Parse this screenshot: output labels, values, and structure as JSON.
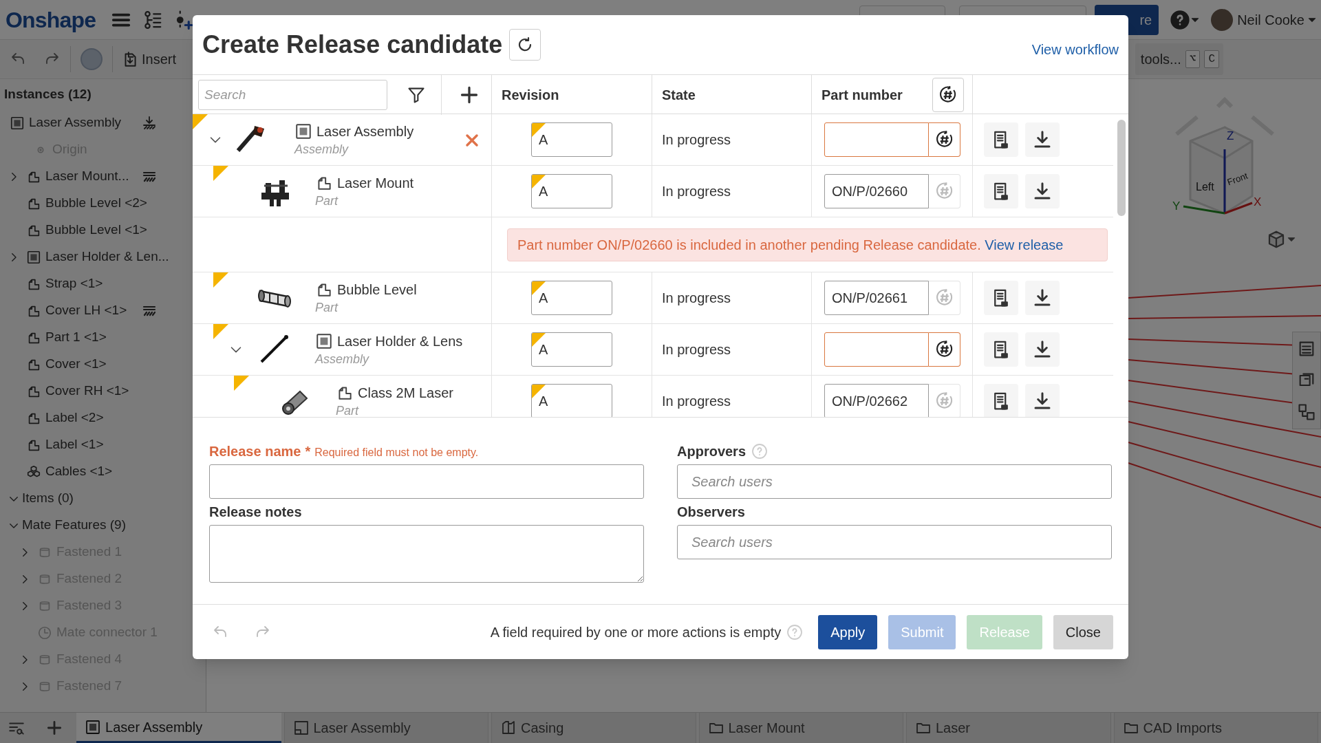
{
  "topbar": {
    "logo": "Onshape",
    "insert": "Insert",
    "share_button": "re",
    "user": "Neil Cooke",
    "search_hint": "tools...",
    "shortcut_keys": [
      "⌥",
      "C"
    ]
  },
  "sidebar": {
    "title": "Instances (12)",
    "tree": [
      {
        "label": "Laser Assembly",
        "kind": "assembly",
        "disabled": false,
        "fixed": true,
        "children": [
          {
            "label": "Origin",
            "kind": "origin",
            "disabled": true
          },
          {
            "label": "Laser Mount...",
            "kind": "part",
            "expanded": false,
            "disabled": false,
            "sectioned": true
          },
          {
            "label": "Bubble Level <2>",
            "kind": "part",
            "disabled": false
          },
          {
            "label": "Bubble Level <1>",
            "kind": "part",
            "disabled": false
          },
          {
            "label": "Laser Holder & Len...",
            "kind": "assembly",
            "expanded": false,
            "disabled": false
          },
          {
            "label": "Strap <1>",
            "kind": "part",
            "disabled": false
          },
          {
            "label": "Cover LH <1>",
            "kind": "part",
            "disabled": false,
            "sectioned": true
          },
          {
            "label": "Part 1 <1>",
            "kind": "part",
            "disabled": false
          },
          {
            "label": "Cover <1>",
            "kind": "part",
            "disabled": false
          },
          {
            "label": "Cover RH <1>",
            "kind": "part",
            "disabled": false
          },
          {
            "label": "Label <2>",
            "kind": "part",
            "disabled": false
          },
          {
            "label": "Label <1>",
            "kind": "part",
            "disabled": false
          },
          {
            "label": "Cables <1>",
            "kind": "multipart",
            "disabled": false
          }
        ]
      },
      {
        "label": "Items (0)",
        "kind": "group",
        "expanded": true,
        "disabled": false
      },
      {
        "label": "Mate Features (9)",
        "kind": "group",
        "expanded": true,
        "disabled": false,
        "children": [
          {
            "label": "Fastened 1",
            "kind": "fastened",
            "expanded": false,
            "disabled": true
          },
          {
            "label": "Fastened 2",
            "kind": "fastened",
            "expanded": false,
            "disabled": true
          },
          {
            "label": "Fastened 3",
            "kind": "fastened",
            "expanded": false,
            "disabled": true
          },
          {
            "label": "Mate connector 1",
            "kind": "connector",
            "disabled": true
          },
          {
            "label": "Fastened 4",
            "kind": "fastened",
            "expanded": false,
            "disabled": true
          },
          {
            "label": "Fastened 7",
            "kind": "fastened",
            "expanded": false,
            "disabled": true
          }
        ]
      }
    ]
  },
  "viewport": {
    "cube_faces": [
      "Left",
      "Front"
    ],
    "axes": [
      {
        "label": "Z"
      },
      {
        "label": "X"
      },
      {
        "label": "Y"
      }
    ]
  },
  "dialog": {
    "title": "Create Release candidate",
    "workflow_link": "View workflow",
    "table": {
      "search_placeholder": "Search",
      "columns": [
        "Revision",
        "State",
        "Part number"
      ],
      "rows": [
        {
          "name": "Laser Assembly",
          "type": "Assembly",
          "kind": "assembly",
          "expanded": true,
          "removable": true,
          "revision": "A",
          "state": "In progress",
          "part_number_invalid": true,
          "children": [
            {
              "name": "Laser Mount",
              "type": "Part",
              "kind": "part",
              "removable": false,
              "revision": "A",
              "state": "In progress",
              "part_number": "ON/P/02660",
              "part_number_invalid": false,
              "message": {
                "text": "Part number ON/P/02660 is included in another pending Release candidate.",
                "link": "View release"
              }
            },
            {
              "name": "Bubble Level",
              "type": "Part",
              "kind": "part",
              "removable": false,
              "revision": "A",
              "state": "In progress",
              "part_number": "ON/P/02661",
              "part_number_invalid": false
            },
            {
              "name": "Laser Holder & Lens",
              "type": "Assembly",
              "kind": "assembly",
              "expanded": true,
              "removable": false,
              "revision": "A",
              "state": "In progress",
              "part_number_invalid": true,
              "children": [
                {
                  "name": "Class 2M Laser",
                  "type": "Part",
                  "kind": "part",
                  "removable": false,
                  "revision": "A",
                  "state": "In progress",
                  "part_number": "ON/P/02662",
                  "part_number_invalid": false
                }
              ]
            }
          ]
        }
      ]
    },
    "form": {
      "release_name": {
        "label": "Release name",
        "required_mark": "*",
        "error": "Required field must not be empty."
      },
      "release_notes": {
        "label": "Release notes"
      },
      "approvers": {
        "label": "Approvers",
        "placeholder": "Search users"
      },
      "observers": {
        "label": "Observers",
        "placeholder": "Search users"
      }
    },
    "footer": {
      "notice": "A field required by one or more actions is empty",
      "buttons": [
        {
          "label": "Apply",
          "kind": "primary",
          "disabled": false
        },
        {
          "label": "Submit",
          "kind": "submit",
          "disabled": true
        },
        {
          "label": "Release",
          "kind": "release",
          "disabled": true
        },
        {
          "label": "Close",
          "kind": "secondary",
          "disabled": false
        }
      ]
    }
  },
  "tabs": [
    {
      "label": "Laser Assembly",
      "kind": "assembly",
      "selected": true
    },
    {
      "label": "Laser Assembly",
      "kind": "drawing",
      "selected": false
    },
    {
      "label": "Casing",
      "kind": "partstudio",
      "selected": false
    },
    {
      "label": "Laser Mount",
      "kind": "folder",
      "selected": false
    },
    {
      "label": "Laser",
      "kind": "folder",
      "selected": false
    },
    {
      "label": "CAD Imports",
      "kind": "folder",
      "selected": false
    }
  ]
}
